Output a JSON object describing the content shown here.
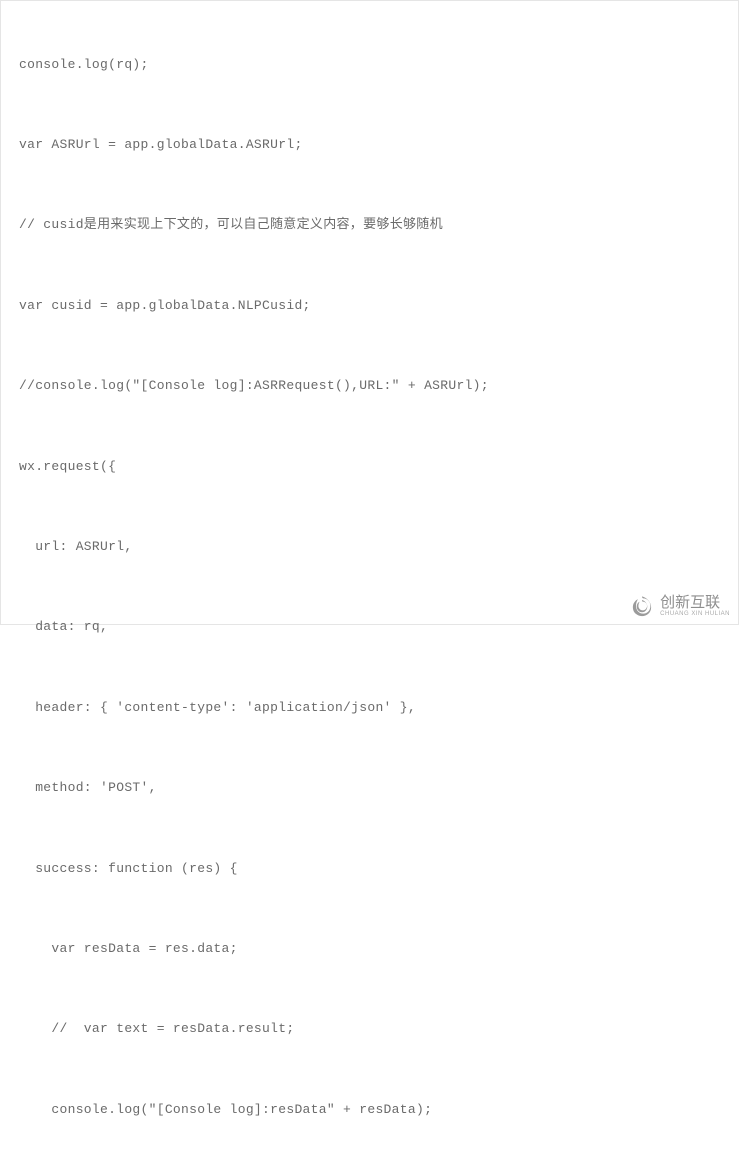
{
  "code": {
    "lines": [
      "console.log(rq);",
      "var ASRUrl = app.globalData.ASRUrl;",
      "// cusid是用来实现上下文的，可以自己随意定义内容，要够长够随机",
      "var cusid = app.globalData.NLPCusid;",
      "//console.log(\"[Console log]:ASRRequest(),URL:\" + ASRUrl);",
      "wx.request({",
      "  url: ASRUrl,",
      "  data: rq,",
      "  header: { 'content-type': 'application/json' },",
      "  method: 'POST',",
      "  success: function (res) {",
      "    var resData = res.data;",
      "    //  var text = resData.result;",
      "    console.log(\"[Console log]:resData\" + resData);"
    ]
  },
  "watermark": {
    "main": "创新互联",
    "sub": "CHUANG XIN HULIAN"
  }
}
